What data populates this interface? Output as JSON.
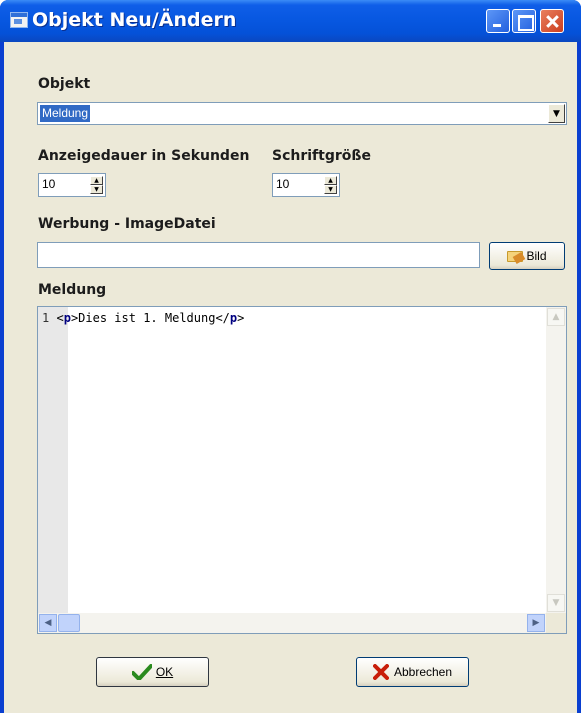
{
  "window": {
    "title": "Objekt Neu/Ändern"
  },
  "objekt": {
    "label": "Objekt",
    "selected": "Meldung"
  },
  "anzeigedauer": {
    "label": "Anzeigedauer in Sekunden",
    "value": "10"
  },
  "schriftgroesse": {
    "label": "Schriftgröße",
    "value": "10"
  },
  "werbung": {
    "label": "Werbung - ImageDatei",
    "value": "",
    "button_label": "Bild"
  },
  "meldung": {
    "label": "Meldung",
    "line_number": "1",
    "code": {
      "open_lt": "<",
      "open_tag": "p",
      "open_gt": ">",
      "text": "Dies ist 1. Meldung",
      "close_lt": "</",
      "close_tag": "p",
      "close_gt": ">"
    }
  },
  "buttons": {
    "ok_label": "OK",
    "cancel_label": "Abbrechen"
  }
}
